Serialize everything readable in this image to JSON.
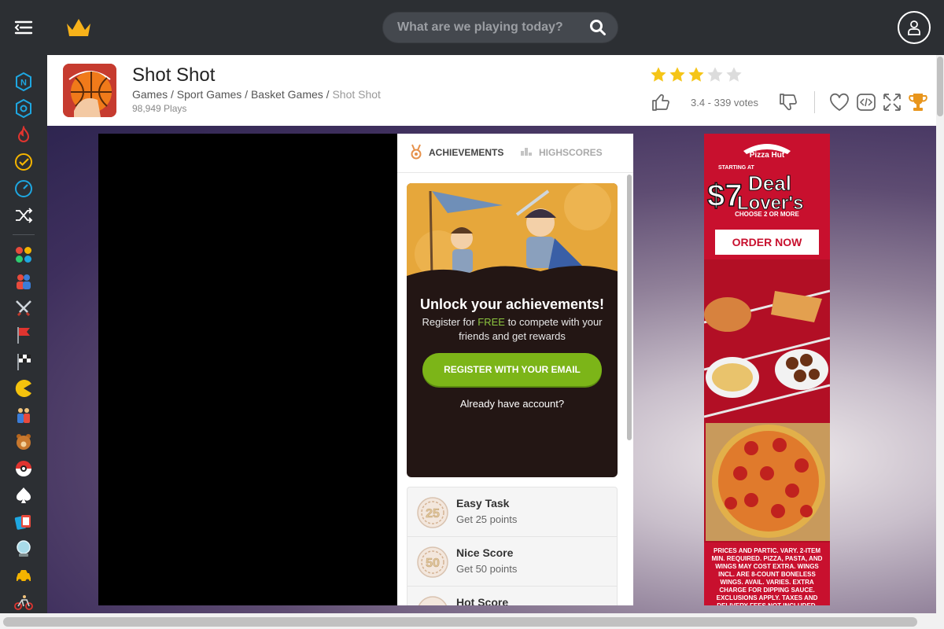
{
  "topbar": {
    "menu_icon": "hamburger-menu-icon",
    "logo_icon": "crown-icon",
    "search": {
      "placeholder": "What are we playing today?",
      "value": "",
      "icon": "search-icon"
    },
    "user_icon": "user-icon"
  },
  "sidebar": {
    "items": [
      {
        "icon": "new-games-icon"
      },
      {
        "icon": "hexagon-icon"
      },
      {
        "icon": "hot-flame-icon"
      },
      {
        "icon": "checkmark-icon"
      },
      {
        "icon": "speedometer-icon"
      },
      {
        "icon": "shuffle-icon"
      },
      {
        "icon": "colored-dots-icon"
      },
      {
        "icon": "two-player-icon"
      },
      {
        "icon": "crossed-swords-icon"
      },
      {
        "icon": "red-flag-icon"
      },
      {
        "icon": "checkered-flag-icon"
      },
      {
        "icon": "pacman-icon"
      },
      {
        "icon": "people-icon"
      },
      {
        "icon": "teddy-bear-icon"
      },
      {
        "icon": "pokeball-icon"
      },
      {
        "icon": "spade-icon"
      },
      {
        "icon": "playing-cards-icon"
      },
      {
        "icon": "crystal-ball-icon"
      },
      {
        "icon": "car-icon"
      },
      {
        "icon": "bicycle-icon"
      }
    ]
  },
  "game": {
    "title": "Shot Shot",
    "breadcrumbs": [
      "Games",
      "Sport Games",
      "Basket Games"
    ],
    "breadcrumb_current": "Shot Shot",
    "plays": "98,949 Plays",
    "rating": {
      "value": 3.4,
      "max": 5,
      "filled_stars": 3
    },
    "votes_text": "3.4 - 339 votes",
    "actions": [
      "heart-icon",
      "embed-code-icon",
      "fullscreen-icon",
      "trophy-icon"
    ],
    "colors": {
      "star_filled": "#f5c518",
      "star_empty": "#dcdcdc",
      "trophy": "#e8951c"
    }
  },
  "panel": {
    "tabs": [
      {
        "label": "ACHIEVEMENTS",
        "icon": "medal-icon",
        "active": true
      },
      {
        "label": "HIGHSCORES",
        "icon": "podium-icon",
        "active": false
      }
    ],
    "promo": {
      "title": "Unlock your achievements!",
      "sub_before": "Register for ",
      "sub_free": "FREE",
      "sub_after": " to compete with your friends and get rewards",
      "register_button": "REGISTER WITH YOUR EMAIL",
      "login_link": "Already have account?"
    },
    "achievements": [
      {
        "badge": "25",
        "name": "Easy Task",
        "desc": "Get 25 points"
      },
      {
        "badge": "50",
        "name": "Nice Score",
        "desc": "Get 50 points"
      },
      {
        "badge": "",
        "name": "Hot Score",
        "desc": ""
      }
    ]
  },
  "ad": {
    "brand": "Pizza Hut",
    "starting_at": "STARTING AT",
    "price": "$7",
    "headline_1": "Deal",
    "headline_2": "Lover's",
    "choose": "CHOOSE 2 OR MORE",
    "cta": "ORDER NOW",
    "legal": "PRICES AND PARTIC. VARY. 2-ITEM MIN. REQUIRED. PIZZA, PASTA, AND WINGS MAY COST EXTRA. WINGS INCL. ARE 8-COUNT BONELESS WINGS. AVAIL. VARIES. EXTRA CHARGE FOR DIPPING SAUCE. EXCLUSIONS APPLY. TAXES AND DELIVERY FEES NOT INCLUDED."
  }
}
